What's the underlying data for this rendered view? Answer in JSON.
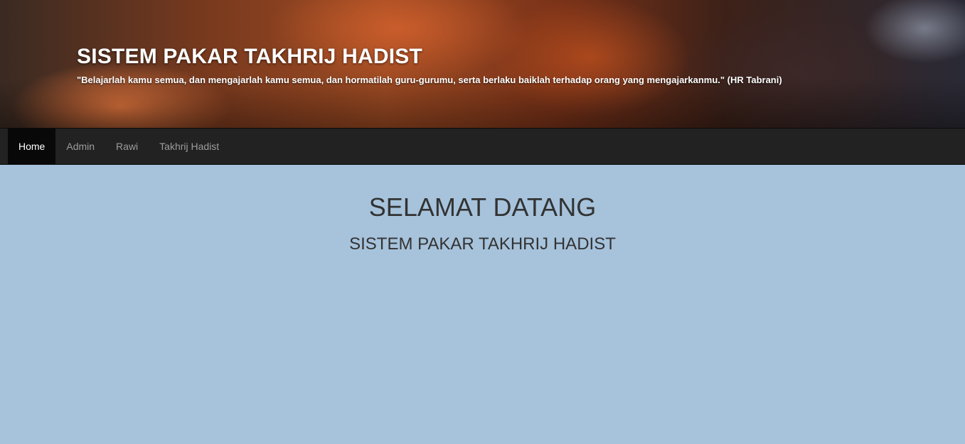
{
  "header": {
    "title": "SISTEM PAKAR TAKHRIJ HADIST",
    "quote": "\"Belajarlah kamu semua, dan mengajarlah kamu semua, dan hormatilah guru-gurumu, serta berlaku baiklah terhadap orang yang mengajarkanmu.\" (HR Tabrani)"
  },
  "nav": {
    "items": [
      {
        "label": "Home",
        "active": true
      },
      {
        "label": "Admin",
        "active": false
      },
      {
        "label": "Rawi",
        "active": false
      },
      {
        "label": "Takhrij Hadist",
        "active": false
      }
    ]
  },
  "main": {
    "heading": "SELAMAT DATANG",
    "subheading": "SISTEM PAKAR TAKHRIJ HADIST"
  },
  "colors": {
    "page_background": "#a7c3dc",
    "navbar_background": "#222222",
    "nav_active_background": "#080808",
    "nav_text": "#9d9d9d",
    "nav_active_text": "#ffffff",
    "body_text": "#333333"
  }
}
